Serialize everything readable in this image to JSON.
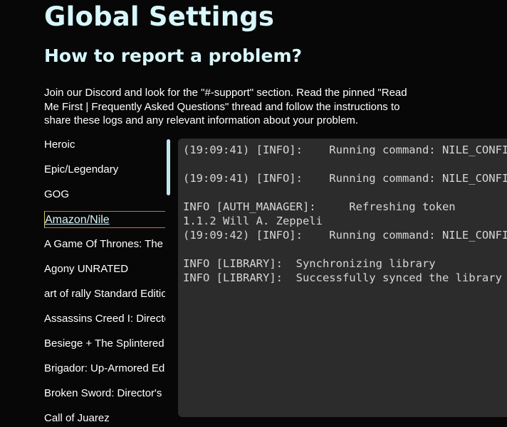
{
  "page": {
    "title": "Global Settings",
    "section_title": "How to report a problem?",
    "instructions": "Join our Discord and look for the \"#-support\" section. Read the pinned \"Read Me First | Frequently Asked Questions\" thread and follow the instructions to share these logs and any relevant information about your problem."
  },
  "sidebar": {
    "active_index": 3,
    "items": [
      {
        "label": "Heroic"
      },
      {
        "label": "Epic/Legendary"
      },
      {
        "label": "GOG"
      },
      {
        "label": "Amazon/Nile"
      },
      {
        "label": "A Game Of Thrones: The Board Game"
      },
      {
        "label": "Agony UNRATED"
      },
      {
        "label": "art of rally Standard Edition"
      },
      {
        "label": "Assassins Creed I: Director's Cut"
      },
      {
        "label": "Besiege + The Splintered Sea"
      },
      {
        "label": "Brigador: Up-Armored Edition"
      },
      {
        "label": "Broken Sword: Director's Cut"
      },
      {
        "label": "Call of Juarez"
      }
    ]
  },
  "log": {
    "text": "(19:09:41) [INFO]:    Running command: NILE_CONFIG_PATH\n\n(19:09:41) [INFO]:    Running command: NILE_CONFIG_PATH\n\nINFO [AUTH_MANAGER]:     Refreshing token\n1.1.2 Will A. Zeppeli\n(19:09:42) [INFO]:    Running command: NILE_CONFIG_PATH\n\nINFO [LIBRARY]:  Synchronizing library\nINFO [LIBRARY]:  Successfully synced the library"
  },
  "colors": {
    "background": "#070707",
    "heading": "#d7f7fd",
    "log_background": "#2c2c2c",
    "active_border": "#e26b24"
  }
}
